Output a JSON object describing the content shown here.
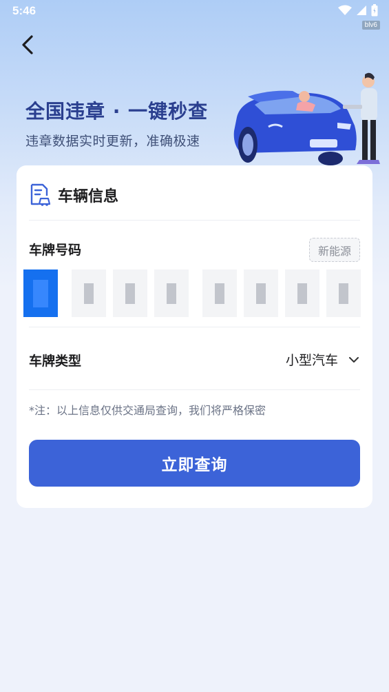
{
  "status_bar": {
    "time": "5:46",
    "tag": "blv6"
  },
  "banner": {
    "title": "全国违章 · 一键秒查",
    "subtitle": "违章数据实时更新，准确极速"
  },
  "card": {
    "title": "车辆信息",
    "plate": {
      "label": "车牌号码",
      "new_energy_label": "新能源",
      "chars": [
        "",
        "",
        "",
        "",
        "",
        "",
        "",
        ""
      ]
    },
    "plate_type": {
      "label": "车牌类型",
      "value": "小型汽车"
    },
    "note": "*注：以上信息仅供交通局查询，我们将严格保密",
    "submit_label": "立即查询"
  },
  "colors": {
    "accent": "#3c63d8",
    "active_slot": "#1570ef",
    "banner_text": "#2a3f8f"
  }
}
